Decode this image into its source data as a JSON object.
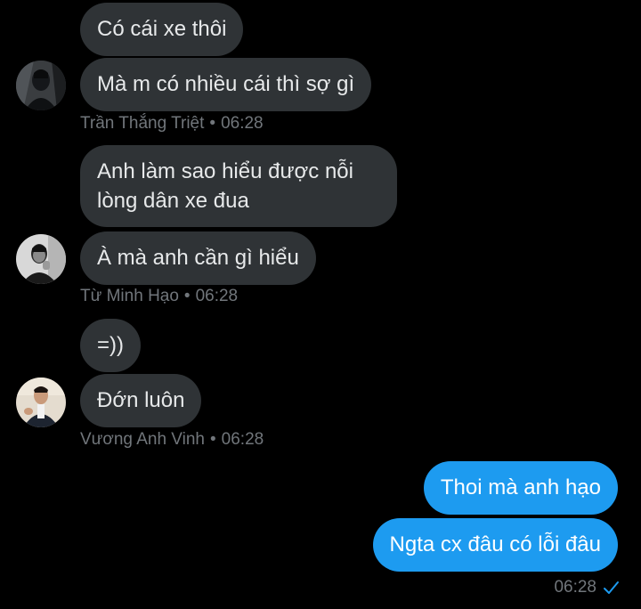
{
  "conversation": {
    "group1": {
      "messages": [
        "Có cái xe thôi",
        "Mà m có nhiều cái thì sợ gì"
      ],
      "sender": "Trần Thắng Triệt",
      "time": "06:28"
    },
    "group2": {
      "messages": [
        "Anh làm sao hiểu được nỗi lòng dân xe đua",
        "À mà anh cần gì hiểu"
      ],
      "sender": "Từ Minh Hạo",
      "time": "06:28"
    },
    "group3": {
      "messages": [
        "=))",
        "Đớn luôn"
      ],
      "sender": "Vương Anh Vinh",
      "time": "06:28"
    },
    "outgoing": {
      "messages": [
        "Thoi mà anh hạo",
        "Ngta cx đâu có lỗi đâu"
      ],
      "time": "06:28",
      "status_icon": "check-icon"
    },
    "separator": "•"
  },
  "colors": {
    "background": "#000000",
    "incoming_bubble": "#2f3336",
    "outgoing_bubble": "#1d9bf0",
    "meta_text": "#71767b",
    "read_check": "#1d9bf0"
  }
}
